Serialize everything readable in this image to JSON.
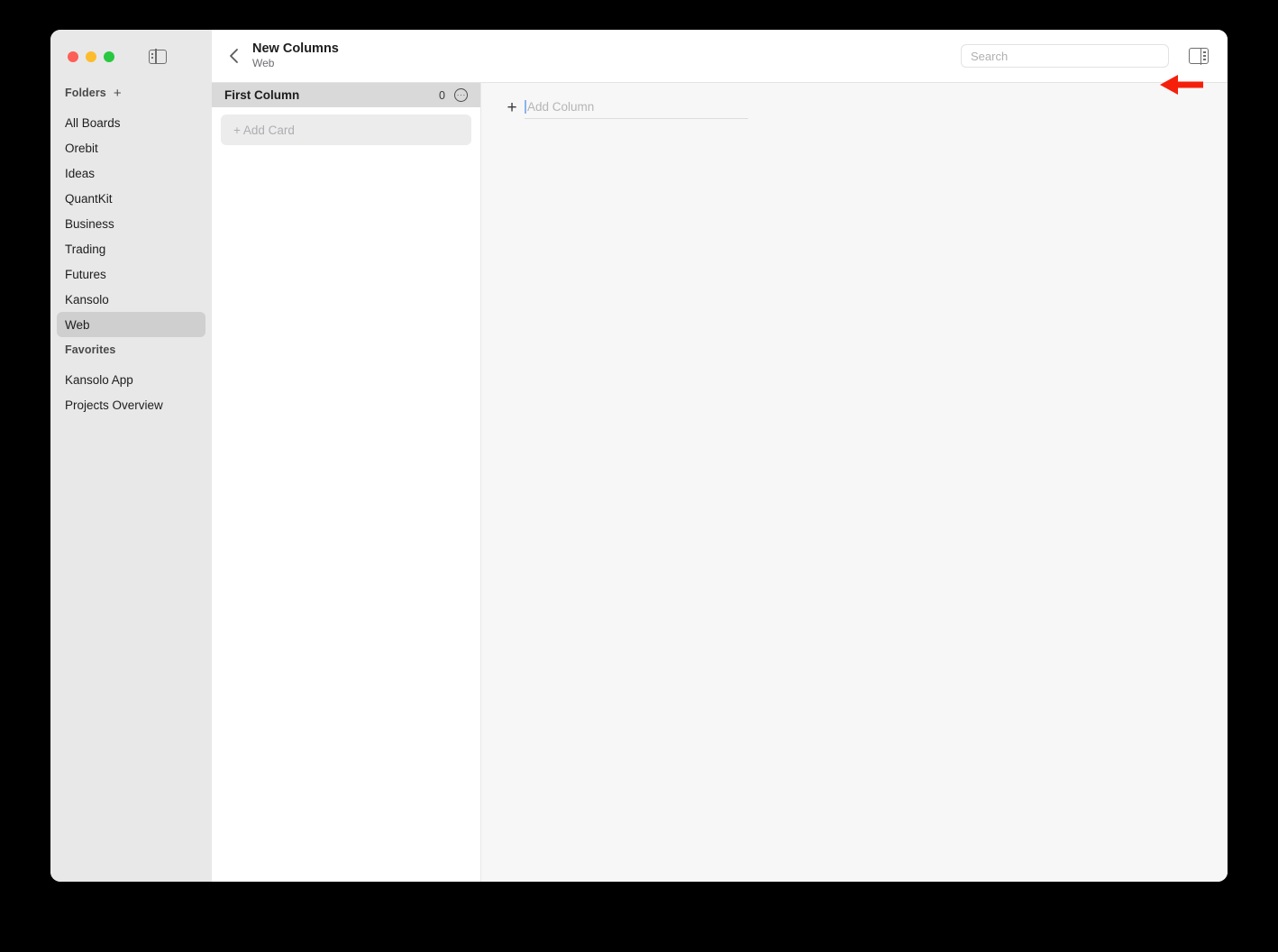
{
  "window": {
    "traffic_lights": [
      "close",
      "minimize",
      "maximize"
    ],
    "sidebar_toggle_icon": "sidebar-toggle-icon",
    "inspector_toggle_icon": "inspector-panel-toggle-icon"
  },
  "sidebar": {
    "sections": [
      {
        "label": "Folders",
        "add_label": "+",
        "items": [
          {
            "label": "All Boards",
            "selected": false
          },
          {
            "label": "Orebit",
            "selected": false
          },
          {
            "label": "Ideas",
            "selected": false
          },
          {
            "label": "QuantKit",
            "selected": false
          },
          {
            "label": "Business",
            "selected": false
          },
          {
            "label": "Trading",
            "selected": false
          },
          {
            "label": "Futures",
            "selected": false
          },
          {
            "label": "Kansolo",
            "selected": false
          },
          {
            "label": "Web",
            "selected": true
          }
        ]
      },
      {
        "label": "Favorites",
        "items": [
          {
            "label": "Kansolo App",
            "selected": false
          },
          {
            "label": "Projects Overview",
            "selected": false
          }
        ]
      }
    ]
  },
  "topbar": {
    "back_icon": "chevron-left-icon",
    "title": "New Columns",
    "subtitle": "Web",
    "search": {
      "value": "",
      "placeholder": "Search"
    }
  },
  "board": {
    "columns": [
      {
        "name": "First Column",
        "count": "0",
        "menu_icon": "ellipsis-circle-icon",
        "add_card_label": "+ Add Card"
      }
    ],
    "add_column": {
      "plus_label": "+",
      "placeholder": "Add Column",
      "value": "",
      "focused": true,
      "caret_color": "#8ab4f0"
    }
  },
  "annotation": {
    "type": "arrow-left",
    "color": "#f5200c",
    "points_at": "add-column-input"
  }
}
